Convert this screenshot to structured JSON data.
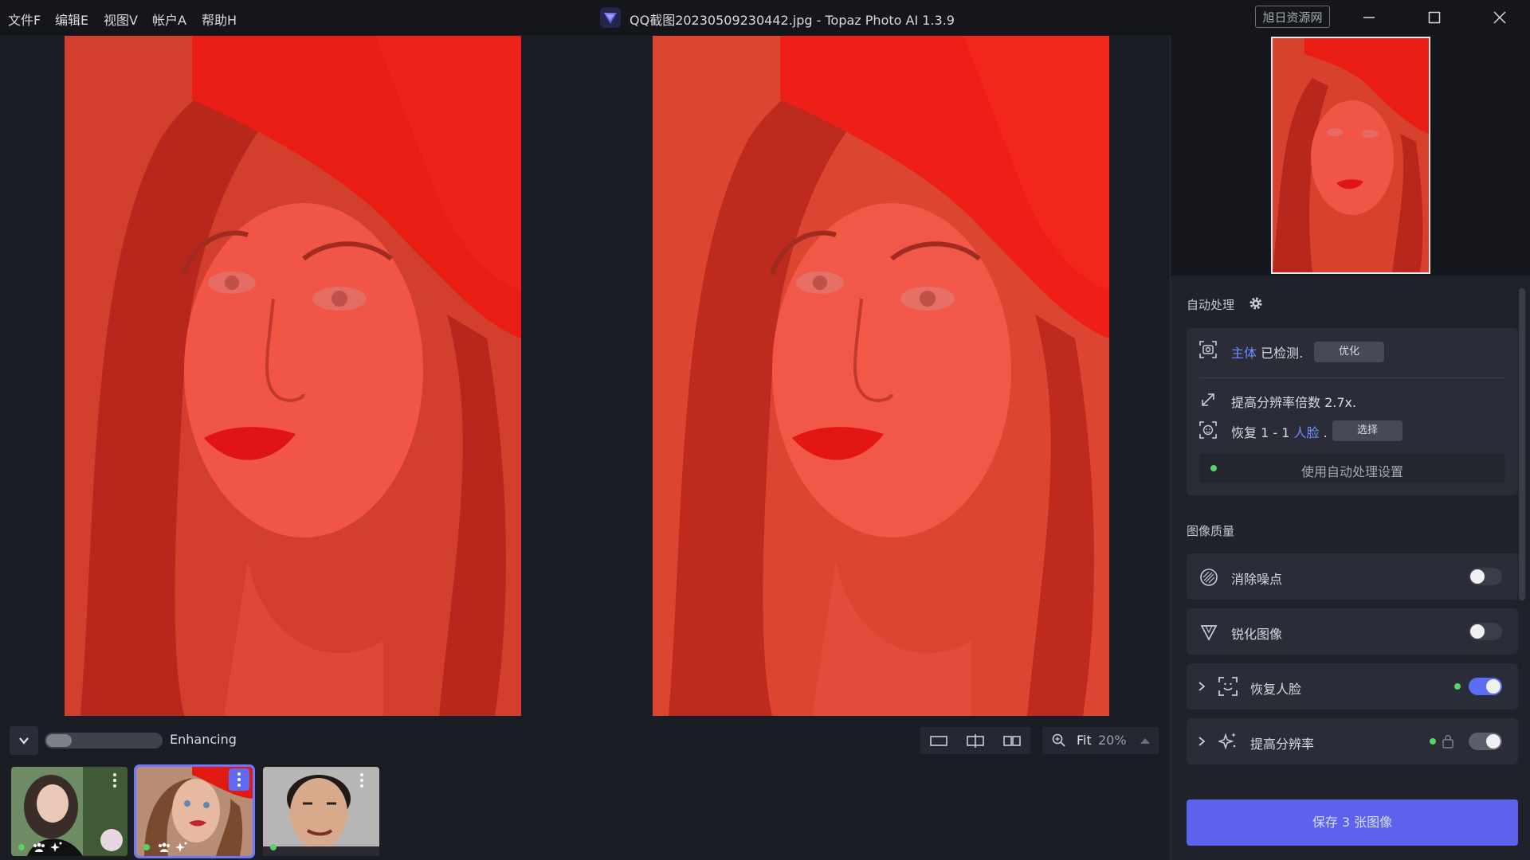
{
  "menu": [
    "文件F",
    "编辑E",
    "视图V",
    "帐户A",
    "帮助H"
  ],
  "window": {
    "title": "QQ截图20230509230442.jpg - Topaz Photo AI 1.3.9",
    "watermark": "旭日资源网"
  },
  "auto_process": {
    "label": "自动处理",
    "subject_link": "主体",
    "subject_status": "已检测.",
    "optimize_btn": "优化",
    "upscale_text": "提高分辨率倍数 2.7x.",
    "face_prefix": "恢复 1 - 1",
    "face_link": "人脸",
    "face_suffix": ".",
    "select_btn": "选择",
    "use_auto_settings": "使用自动处理设置"
  },
  "image_quality": {
    "label": "图像质量",
    "items": [
      {
        "label": "消除噪点",
        "icon": "denoise-icon",
        "on": false
      },
      {
        "label": "锐化图像",
        "icon": "sharpen-icon",
        "on": false
      },
      {
        "label": "恢复人脸",
        "icon": "face-recovery-icon",
        "on": true
      },
      {
        "label": "提高分辨率",
        "icon": "upscale-icon",
        "on": true
      }
    ]
  },
  "save_button": "保存 3 张图像",
  "status": {
    "progress_label": "Enhancing"
  },
  "zoom": {
    "fit_label": "Fit",
    "percent": "20%"
  },
  "colors": {
    "accent": "#5b63ee",
    "link": "#6e8dff",
    "toggle_on": "#5b6cf5",
    "status_dot": "#56d364",
    "photo_tint": "#e8322a"
  }
}
